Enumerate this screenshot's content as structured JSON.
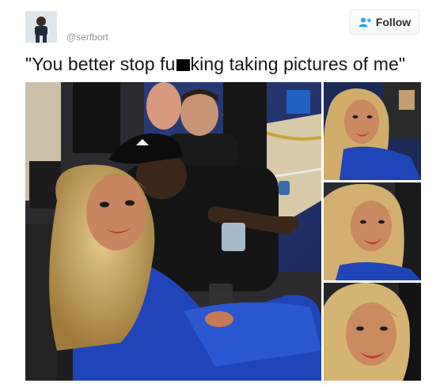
{
  "user": {
    "handle": "@serfbort",
    "avatar_icon": "user-avatar-icon"
  },
  "follow_button": {
    "label": "Follow",
    "icon": "person-add-icon",
    "accent": "#1da1f2"
  },
  "tweet": {
    "text_before": "\"You better stop fu",
    "text_after": "king taking pictures of me\""
  },
  "media": {
    "photos": [
      {
        "name": "main-photo"
      },
      {
        "name": "selfie-1"
      },
      {
        "name": "selfie-2"
      },
      {
        "name": "selfie-3"
      }
    ]
  }
}
